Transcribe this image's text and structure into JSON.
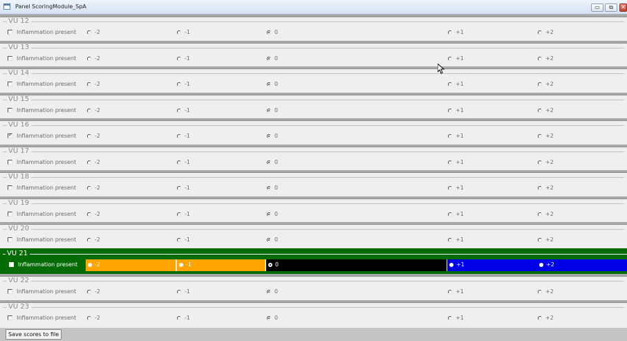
{
  "window": {
    "title": "Panel ScoringModule_SpA",
    "controls": {
      "minimize": "▭",
      "maximize": "⧉",
      "close": "✕"
    }
  },
  "checkbox_label": "Inflammation present",
  "radio_labels": [
    "-2",
    "-1",
    "0",
    "+1",
    "+2"
  ],
  "groups": [
    {
      "title": "VU 12",
      "inflammation_checked": false,
      "selected": "0"
    },
    {
      "title": "VU 13",
      "inflammation_checked": false,
      "selected": "0"
    },
    {
      "title": "VU 14",
      "inflammation_checked": false,
      "selected": "0"
    },
    {
      "title": "VU 15",
      "inflammation_checked": false,
      "selected": "0"
    },
    {
      "title": "VU 16",
      "inflammation_checked": true,
      "selected": "0"
    },
    {
      "title": "VU 17",
      "inflammation_checked": false,
      "selected": "0"
    },
    {
      "title": "VU 18",
      "inflammation_checked": false,
      "selected": "0"
    },
    {
      "title": "VU 19",
      "inflammation_checked": false,
      "selected": "0"
    },
    {
      "title": "VU 20",
      "inflammation_checked": false,
      "selected": "0"
    },
    {
      "title": "VU 21",
      "inflammation_checked": false,
      "selected": "0",
      "highlighted": true
    },
    {
      "title": "VU 22",
      "inflammation_checked": false,
      "selected": "0"
    },
    {
      "title": "VU 23",
      "inflammation_checked": false,
      "selected": "0"
    }
  ],
  "highlight_colors": {
    "frame": "#056b05",
    "negative": "#ffa400",
    "zero": "#000000",
    "positive": "#0000e6"
  },
  "footer": {
    "save_button": "Save scores to file"
  }
}
